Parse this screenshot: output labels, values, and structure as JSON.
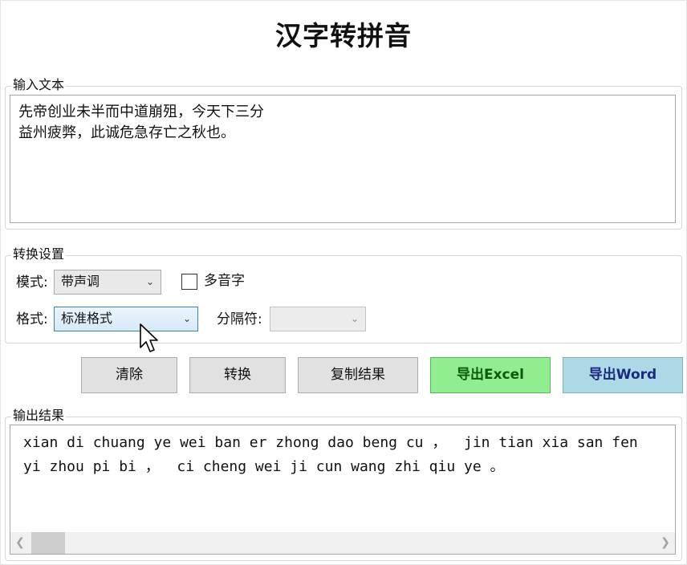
{
  "app": {
    "title": "汉字转拼音"
  },
  "input_group": {
    "label": "输入文本",
    "text": "先帝创业未半而中道崩殂，今天下三分\n益州疲弊，此诚危急存亡之秋也。"
  },
  "settings": {
    "label": "转换设置",
    "mode_label": "模式:",
    "mode_value": "带声调",
    "polyphone_label": "多音字",
    "polyphone_checked": false,
    "format_label": "格式:",
    "format_value": "标准格式",
    "separator_label": "分隔符:",
    "separator_value": ""
  },
  "buttons": {
    "clear": "清除",
    "convert": "转换",
    "copy": "复制结果",
    "export_excel": "导出Excel",
    "export_word": "导出Word"
  },
  "output_group": {
    "label": "输出结果",
    "text": "xian di chuang ye wei ban er zhong dao beng cu ，  jin tian xia san fen\nyi zhou pi bi ，  ci cheng wei ji cun wang zhi qiu ye 。"
  },
  "icons": {
    "chevron": "chevron-down-icon",
    "scroll_left": "scroll-left-icon",
    "scroll_right": "scroll-right-icon",
    "cursor": "mouse-pointer-icon"
  },
  "colors": {
    "excel_button": "#90ee90",
    "word_button": "#add8e6",
    "focus_combo": "#d6eaf8"
  }
}
